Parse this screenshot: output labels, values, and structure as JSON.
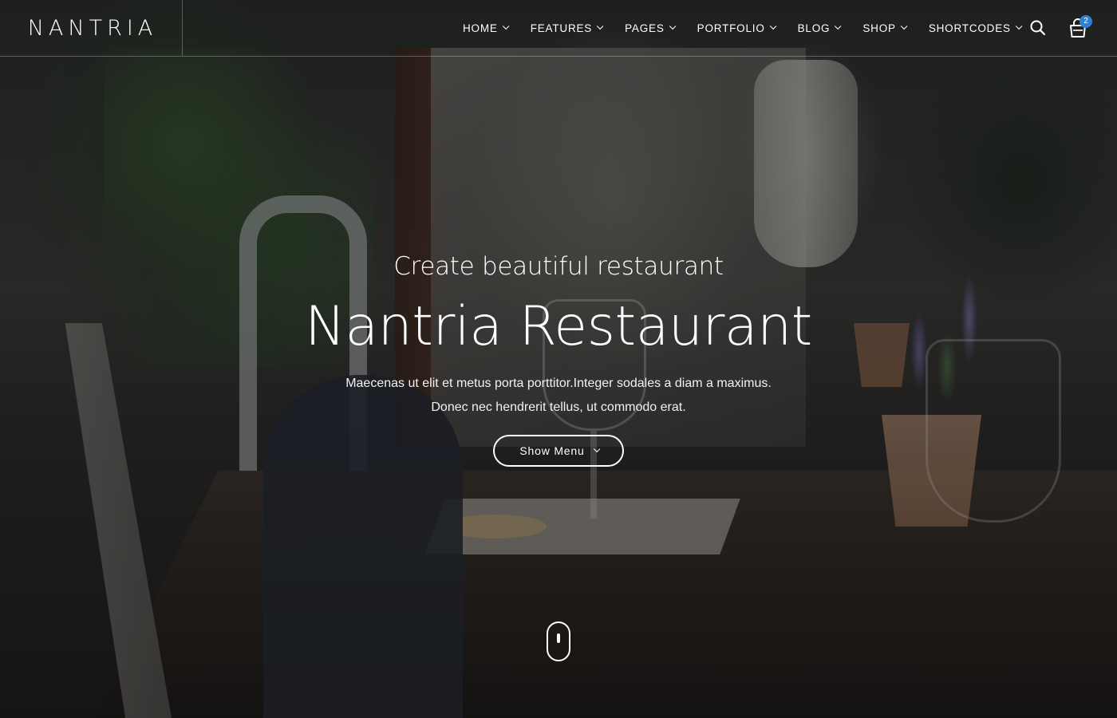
{
  "header": {
    "logo_text": "NANTRIA",
    "nav": [
      {
        "label": "HOME",
        "icon": "chevron-down-icon"
      },
      {
        "label": "FEATURES",
        "icon": "chevron-down-icon"
      },
      {
        "label": "PAGES",
        "icon": "chevron-down-icon"
      },
      {
        "label": "PORTFOLIO",
        "icon": "chevron-down-icon"
      },
      {
        "label": "BLOG",
        "icon": "chevron-down-icon"
      },
      {
        "label": "SHOP",
        "icon": "chevron-down-icon"
      },
      {
        "label": "SHORTCODES",
        "icon": "chevron-down-icon"
      }
    ],
    "search_icon": "search-icon",
    "cart_icon": "shopping-bag-icon",
    "cart_count": "2",
    "badge_color": "#2e7fd8"
  },
  "hero": {
    "subtitle": "Create beautiful restaurant",
    "title": "Nantria Restaurant",
    "text_line1": "Maecenas ut elit et metus porta porttitor.Integer sodales a diam a maximus.",
    "text_line2": "Donec nec hendrerit tellus, ut commodo erat.",
    "button_label": "Show Menu",
    "button_icon": "chevron-down-icon",
    "scroll_icon": "scroll-mouse-icon"
  }
}
